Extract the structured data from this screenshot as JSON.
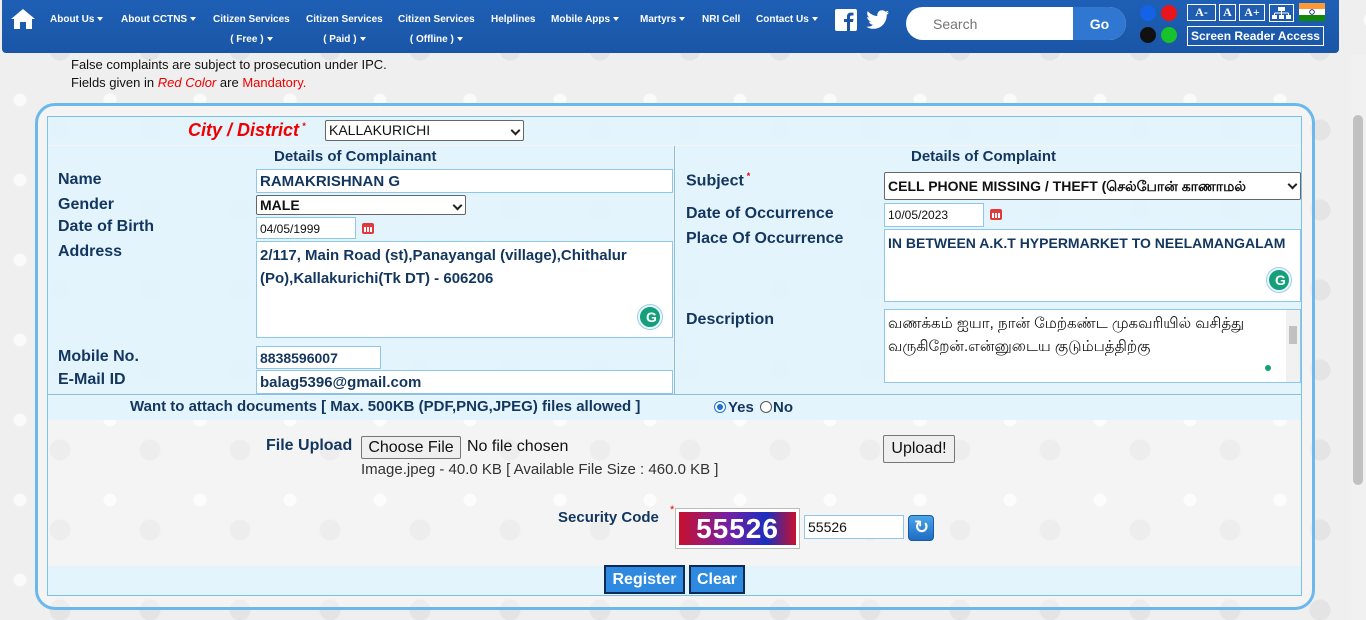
{
  "nav": {
    "items": [
      {
        "line1": "About Us",
        "line2": "",
        "caret": true
      },
      {
        "line1": "About CCTNS",
        "line2": "",
        "caret": true
      },
      {
        "line1": "Citizen Services",
        "line2": "( Free )",
        "caret": true
      },
      {
        "line1": "Citizen Services",
        "line2": "( Paid )",
        "caret": true
      },
      {
        "line1": "Citizen Services",
        "line2": "( Offline )",
        "caret": true
      },
      {
        "line1": "Helplines",
        "line2": "",
        "caret": false
      },
      {
        "line1": "Mobile Apps",
        "line2": "",
        "caret": true
      },
      {
        "line1": "Martyrs",
        "line2": "",
        "caret": true
      },
      {
        "line1": "NRI Cell",
        "line2": "",
        "caret": false
      },
      {
        "line1": "Contact Us",
        "line2": "",
        "caret": true
      }
    ],
    "search_placeholder": "Search",
    "go_label": "Go",
    "font_buttons": [
      "A-",
      "A",
      "A+"
    ],
    "screen_reader_label": "Screen Reader Access",
    "theme_colors": [
      "#1463e6",
      "#e8161b",
      "#111111",
      "#19c12a"
    ]
  },
  "notices": {
    "line1": "False complaints are subject to prosecution under IPC.",
    "line2_prefix": "Fields given in",
    "line2_red": "Red Color",
    "line2_mid": "are",
    "line2_mandatory": "Mandatory."
  },
  "form": {
    "city_label": "City / District",
    "city_value": "KALLAKURICHI",
    "complainant": {
      "header": "Details of Complainant",
      "name_label": "Name",
      "name_value": "RAMAKRISHNAN G",
      "gender_label": "Gender",
      "gender_value": "MALE",
      "dob_label": "Date of Birth",
      "dob_value": "04/05/1999",
      "address_label": "Address",
      "address_value": "2/117, Main Road (st),Panayangal (village),Chithalur (Po),Kallakurichi(Tk DT) - 606206",
      "mobile_label": "Mobile No.",
      "mobile_value": "8838596007",
      "email_label": "E-Mail ID",
      "email_value": "balag5396@gmail.com"
    },
    "complaint": {
      "header": "Details of Complaint",
      "subject_label": "Subject",
      "subject_value": "CELL PHONE MISSING / THEFT (செல்போன் காணாமல்",
      "date_label": "Date of Occurrence",
      "date_value": "10/05/2023",
      "place_label": "Place Of Occurrence",
      "place_value": "IN  BETWEEN A.K.T HYPERMARKET TO NEELAMANGALAM",
      "description_label": "Description",
      "description_value": "வணக்கம் ஐயா, நான் மேற்கண்ட முகவரியில் வசித்து வருகிறேன்.என்னுடைய குடும்பத்திற்கு"
    },
    "attach": {
      "question": "Want to attach documents [ Max. 500KB (PDF,PNG,JPEG) files allowed ]",
      "yes": "Yes",
      "no": "No"
    },
    "upload": {
      "label": "File Upload",
      "choose_label": "Choose File",
      "no_file": "No file chosen",
      "info": "Image.jpeg - 40.0 KB [ Available File Size : 460.0 KB ]",
      "upload_label": "Upload!"
    },
    "security": {
      "label": "Security Code",
      "captcha": "55526",
      "entered": "55526"
    },
    "register_label": "Register",
    "clear_label": "Clear"
  }
}
